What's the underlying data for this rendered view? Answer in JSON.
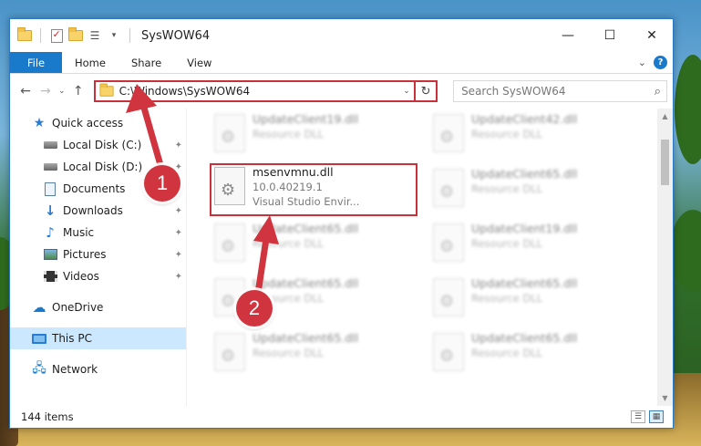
{
  "window": {
    "title": "SysWOW64",
    "controls": {
      "minimize": "—",
      "maximize": "☐",
      "close": "✕"
    }
  },
  "ribbon": {
    "tabs": [
      {
        "label": "File"
      },
      {
        "label": "Home"
      },
      {
        "label": "Share"
      },
      {
        "label": "View"
      }
    ],
    "expand": "⌄",
    "help": "?"
  },
  "nav": {
    "back": "←",
    "forward": "→",
    "recent": "⌄",
    "up": "↑",
    "address": "C:\\Windows\\SysWOW64",
    "address_dropdown": "⌄",
    "refresh": "↻",
    "search_placeholder": "Search SysWOW64",
    "search_icon": "⌕"
  },
  "sidebar": {
    "items": [
      {
        "label": "Quick access",
        "icon": "star-icon"
      },
      {
        "label": "Local Disk (C:)",
        "icon": "drive-icon",
        "pinned": true
      },
      {
        "label": "Local Disk (D:)",
        "icon": "drive-icon",
        "pinned": true
      },
      {
        "label": "Documents",
        "icon": "documents-icon",
        "pinned": true
      },
      {
        "label": "Downloads",
        "icon": "downloads-icon",
        "pinned": true
      },
      {
        "label": "Music",
        "icon": "music-icon",
        "pinned": true
      },
      {
        "label": "Pictures",
        "icon": "pictures-icon",
        "pinned": true
      },
      {
        "label": "Videos",
        "icon": "videos-icon",
        "pinned": true
      },
      {
        "label": "OneDrive",
        "icon": "onedrive-icon"
      },
      {
        "label": "This PC",
        "icon": "this-pc-icon"
      },
      {
        "label": "Network",
        "icon": "network-icon"
      }
    ],
    "pin_glyph": "📌"
  },
  "files": {
    "left": [
      {
        "name": "UpdateClient19.dll",
        "line1": "Resource DLL",
        "line2": ""
      },
      {
        "name": "msenvmnu.dll",
        "line1": "10.0.40219.1",
        "line2": "Visual Studio Envir..."
      },
      {
        "name": "UpdateClient65.dll",
        "line1": "Resource DLL",
        "line2": ""
      },
      {
        "name": "UpdateClient65.dll",
        "line1": "Resource DLL",
        "line2": ""
      },
      {
        "name": "UpdateClient65.dll",
        "line1": "Resource DLL",
        "line2": ""
      }
    ],
    "right": [
      {
        "name": "UpdateClient42.dll",
        "line1": "Resource DLL"
      },
      {
        "name": "UpdateClient65.dll",
        "line1": "Resource DLL"
      },
      {
        "name": "UpdateClient19.dll",
        "line1": "Resource DLL"
      },
      {
        "name": "UpdateClient65.dll",
        "line1": "Resource DLL"
      },
      {
        "name": "UpdateClient65.dll",
        "line1": "Resource DLL"
      }
    ]
  },
  "status": {
    "count": "144 items"
  },
  "annotations": {
    "badge1": "1",
    "badge2": "2"
  },
  "colors": {
    "accent": "#1979ca",
    "highlight": "#c8303a",
    "selected": "#cce8ff"
  }
}
